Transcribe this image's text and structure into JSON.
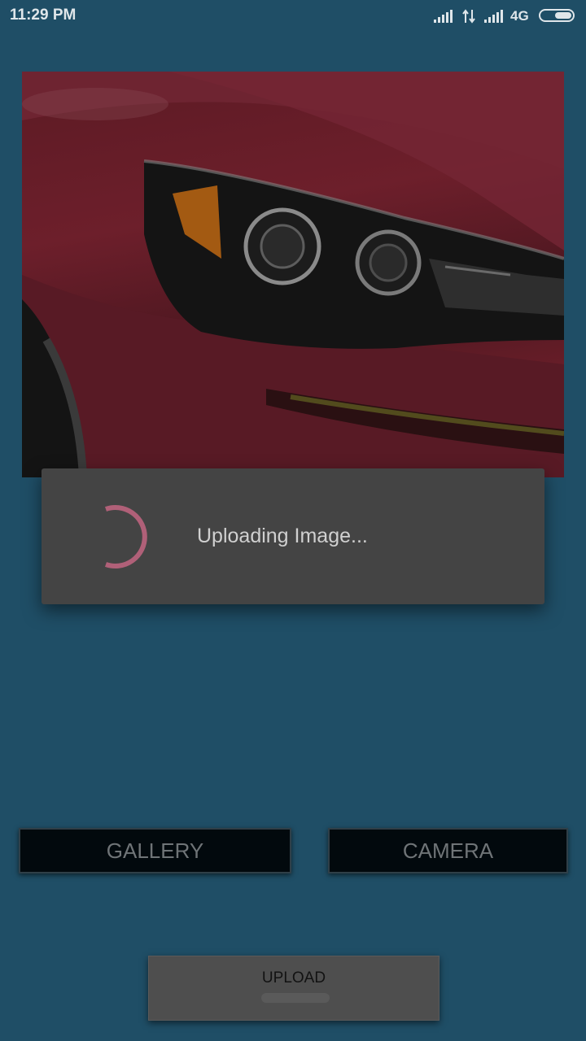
{
  "status_bar": {
    "time": "11:29 PM",
    "network": "4G",
    "icons": [
      "signal-icon",
      "data-transfer-icon",
      "signal-icon",
      "battery-icon"
    ]
  },
  "image_preview": {
    "description_icon": "car-headlight-photo"
  },
  "progress_dialog": {
    "message": "Uploading Image...",
    "spinner_color": "#b06078"
  },
  "buttons": {
    "gallery": "GALLERY",
    "camera": "CAMERA",
    "upload": "UPLOAD"
  },
  "colors": {
    "background": "#1f4e66",
    "dialog": "#444444",
    "dark_button": "#02090d"
  }
}
